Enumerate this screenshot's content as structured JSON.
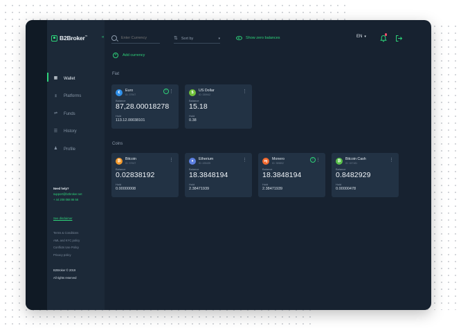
{
  "brand": {
    "name": "B2Broker",
    "tm": "™"
  },
  "nav": [
    {
      "label": "Wallet",
      "icon": "wallet-icon",
      "active": true
    },
    {
      "label": "Platforms",
      "icon": "chart-icon",
      "active": false
    },
    {
      "label": "Funds",
      "icon": "funds-icon",
      "active": false
    },
    {
      "label": "History",
      "icon": "history-icon",
      "active": false
    },
    {
      "label": "Profile",
      "icon": "profile-icon",
      "active": false
    }
  ],
  "help": {
    "title": "Need help?",
    "email": "support@b2broker.net",
    "phone": "+ 44 208 068 86 56"
  },
  "disclaimer": "See disclaimer",
  "legal": [
    "Terms & Conditions",
    "AML and KYC policy",
    "Conflicts Use Policy",
    "Privacy policy"
  ],
  "copyright": [
    "B2Broker © 2019",
    "All rights reserved"
  ],
  "toolbar": {
    "search_placeholder": "Enter Currency",
    "sort_label": "Sort by",
    "show_zero": "Show zero balances",
    "lang": "EN",
    "add_currency": "Add currency"
  },
  "sections": {
    "fiat": "Fiat",
    "coins": "Coins"
  },
  "fiat_cards": [
    {
      "name": "Euro",
      "id": "ID: 37947",
      "symbol": "€",
      "color": "#2f8fe8",
      "balance_label": "Balance",
      "balance": "87,28.00018278",
      "hold_label": "Hold",
      "hold": "113.12.00038101",
      "info": true
    },
    {
      "name": "US Dollar",
      "id": "ID: 339942",
      "symbol": "$",
      "color": "#6fbf3a",
      "balance_label": "Balance",
      "balance": "15.18",
      "hold_label": "Hold",
      "hold": "0.38",
      "info": false
    }
  ],
  "coin_cards": [
    {
      "name": "Bitcoin",
      "id": "ID: 37947",
      "symbol": "₿",
      "color": "#f29a2e",
      "balance_label": "Balance",
      "balance": "0.02838192",
      "hold_label": "Hold",
      "hold": "0.00000008",
      "info": false
    },
    {
      "name": "Etherium",
      "id": "ID: 435435",
      "symbol": "♦",
      "color": "#5c7fe0",
      "balance_label": "Balance",
      "balance": "18.3848194",
      "hold_label": "Hold",
      "hold": "2.38471939",
      "info": false
    },
    {
      "name": "Monero",
      "id": "ID: 355852",
      "symbol": "ɱ",
      "color": "#f2692e",
      "balance_label": "Balance",
      "balance": "18.3848194",
      "hold_label": "Hold",
      "hold": "2.38471939",
      "info": true
    },
    {
      "name": "Bitcoin Cash",
      "id": "ID: 157181",
      "symbol": "₿",
      "color": "#58bf4a",
      "balance_label": "Balance",
      "balance": "0.8482929",
      "hold_label": "Hold",
      "hold": "0.00000478",
      "info": false
    }
  ]
}
